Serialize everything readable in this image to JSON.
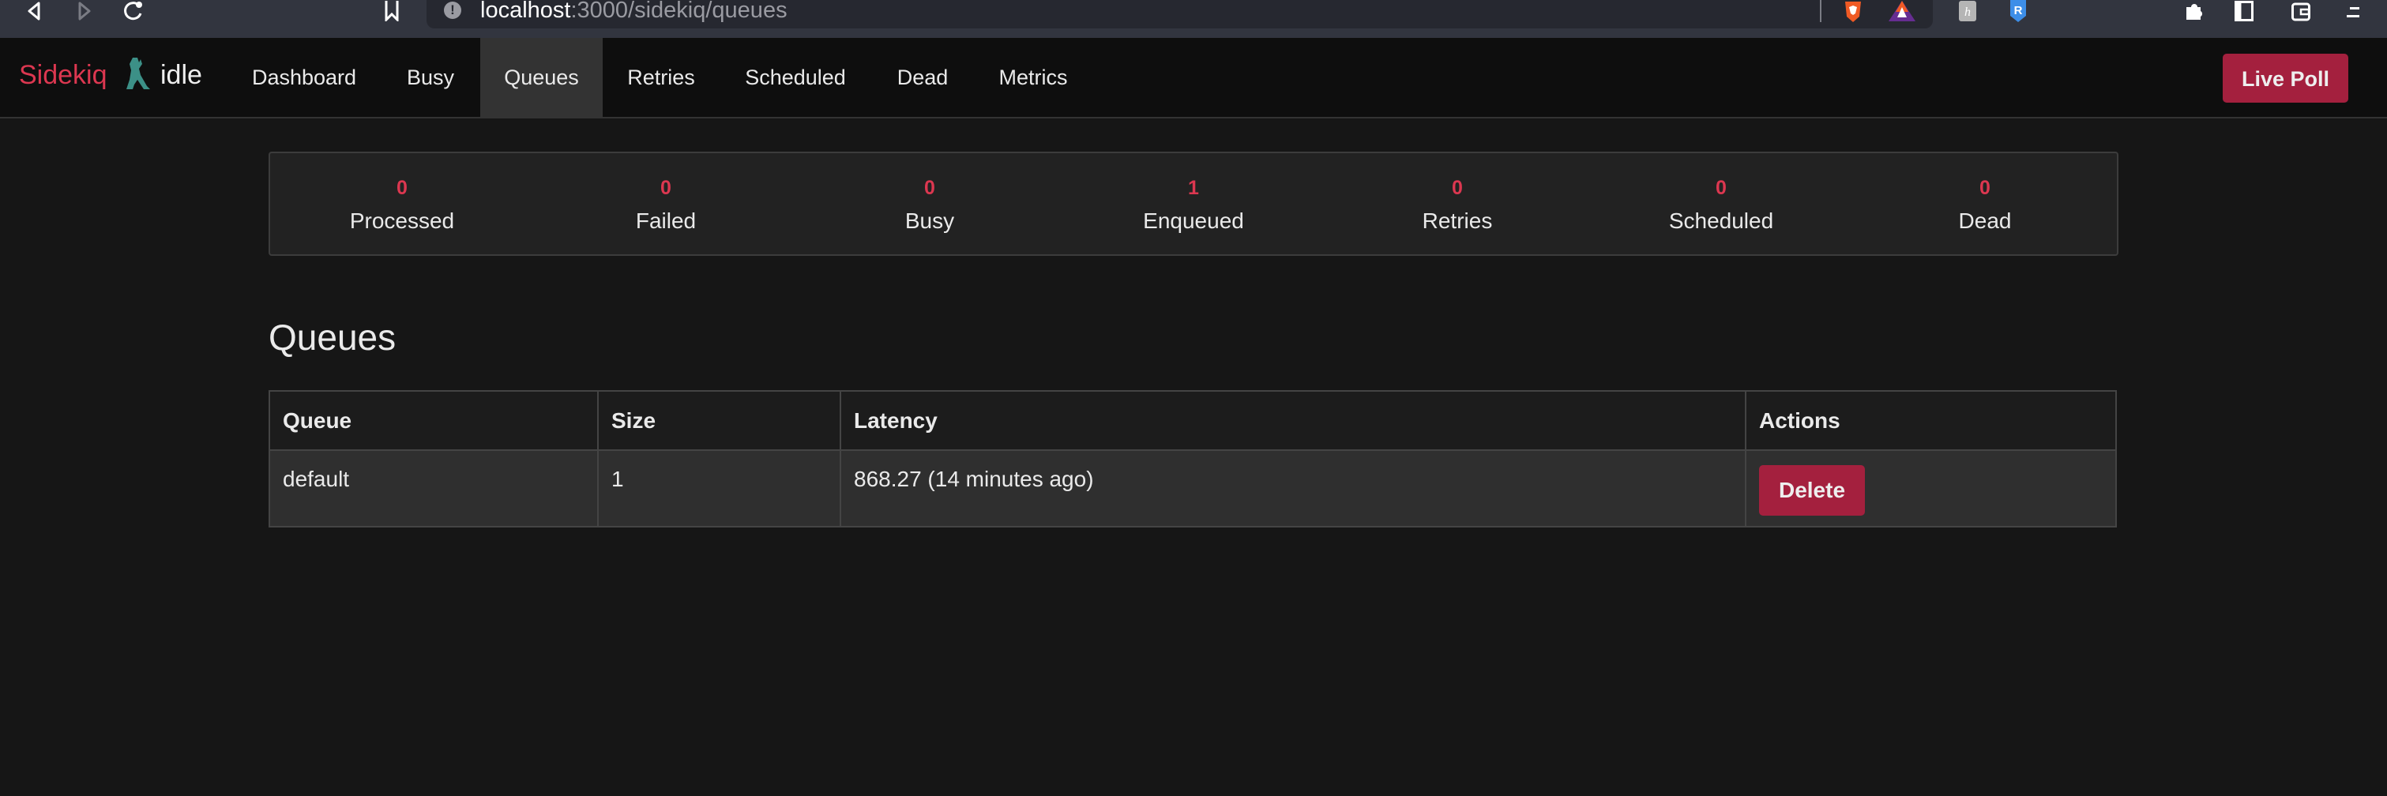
{
  "browser": {
    "url_host": "localhost",
    "url_path": ":3000/sidekiq/queues",
    "icons": [
      "back-icon",
      "forward-icon",
      "reload-icon",
      "bookmark-icon",
      "site-info-icon",
      "brave-shields-icon",
      "brave-rewards-icon",
      "extension-h-icon",
      "extension-shield-icon",
      "extensions-puzzle-icon",
      "sidebar-icon",
      "wallet-icon",
      "menu-icon"
    ]
  },
  "navbar": {
    "brand": "Sidekiq",
    "status": "idle",
    "items": [
      {
        "label": "Dashboard",
        "active": false
      },
      {
        "label": "Busy",
        "active": false
      },
      {
        "label": "Queues",
        "active": true
      },
      {
        "label": "Retries",
        "active": false
      },
      {
        "label": "Scheduled",
        "active": false
      },
      {
        "label": "Dead",
        "active": false
      },
      {
        "label": "Metrics",
        "active": false
      }
    ],
    "live_poll_label": "Live Poll"
  },
  "stats": [
    {
      "count": "0",
      "label": "Processed"
    },
    {
      "count": "0",
      "label": "Failed"
    },
    {
      "count": "0",
      "label": "Busy"
    },
    {
      "count": "1",
      "label": "Enqueued"
    },
    {
      "count": "0",
      "label": "Retries"
    },
    {
      "count": "0",
      "label": "Scheduled"
    },
    {
      "count": "0",
      "label": "Dead"
    }
  ],
  "page": {
    "title": "Queues"
  },
  "table": {
    "headers": [
      "Queue",
      "Size",
      "Latency",
      "Actions"
    ],
    "rows": [
      {
        "queue": "default",
        "size": "1",
        "latency": "868.27 (14 minutes ago)",
        "action_label": "Delete"
      }
    ]
  },
  "colors": {
    "accent": "#dc3750",
    "button": "#a4203e",
    "background": "#161616",
    "navbar": "#0e0e0e"
  }
}
